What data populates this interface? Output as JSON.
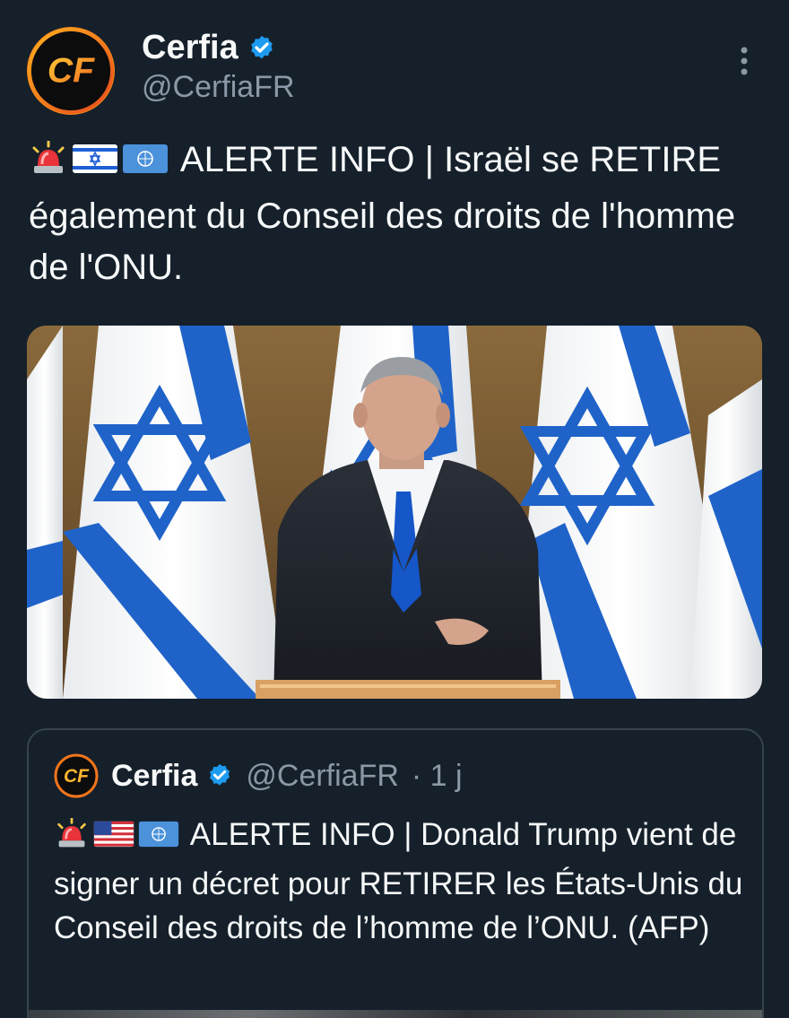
{
  "tweet": {
    "author": {
      "display_name": "Cerfia",
      "handle": "@CerfiaFR",
      "verified": true,
      "avatar_text": "CF"
    },
    "menu_icon": "more-vertical-icon",
    "text_emojis": [
      "police-light",
      "flag-israel",
      "flag-un"
    ],
    "text": "ALERTE INFO | Israël se RETIRE également du Conseil des droits de l'homme de l'ONU.",
    "media": {
      "description_icon": "photo-israel-flags-speaker"
    }
  },
  "quoted_tweet": {
    "author": {
      "display_name": "Cerfia",
      "handle": "@CerfiaFR",
      "time": "· 1 j",
      "verified": true,
      "avatar_text": "CF"
    },
    "text_emojis": [
      "police-light",
      "flag-usa",
      "flag-un"
    ],
    "text": "ALERTE INFO | Donald Trump vient de signer un décret pour RETIRER les États-Unis du Conseil des droits de l’homme de l’ONU. (AFP)"
  },
  "colors": {
    "background": "#15202b",
    "text": "#f7f9f9",
    "secondary_text": "#8b98a5",
    "verified_blue": "#1d9bf0",
    "border": "#38444d",
    "brand_orange": "#f58a18"
  }
}
